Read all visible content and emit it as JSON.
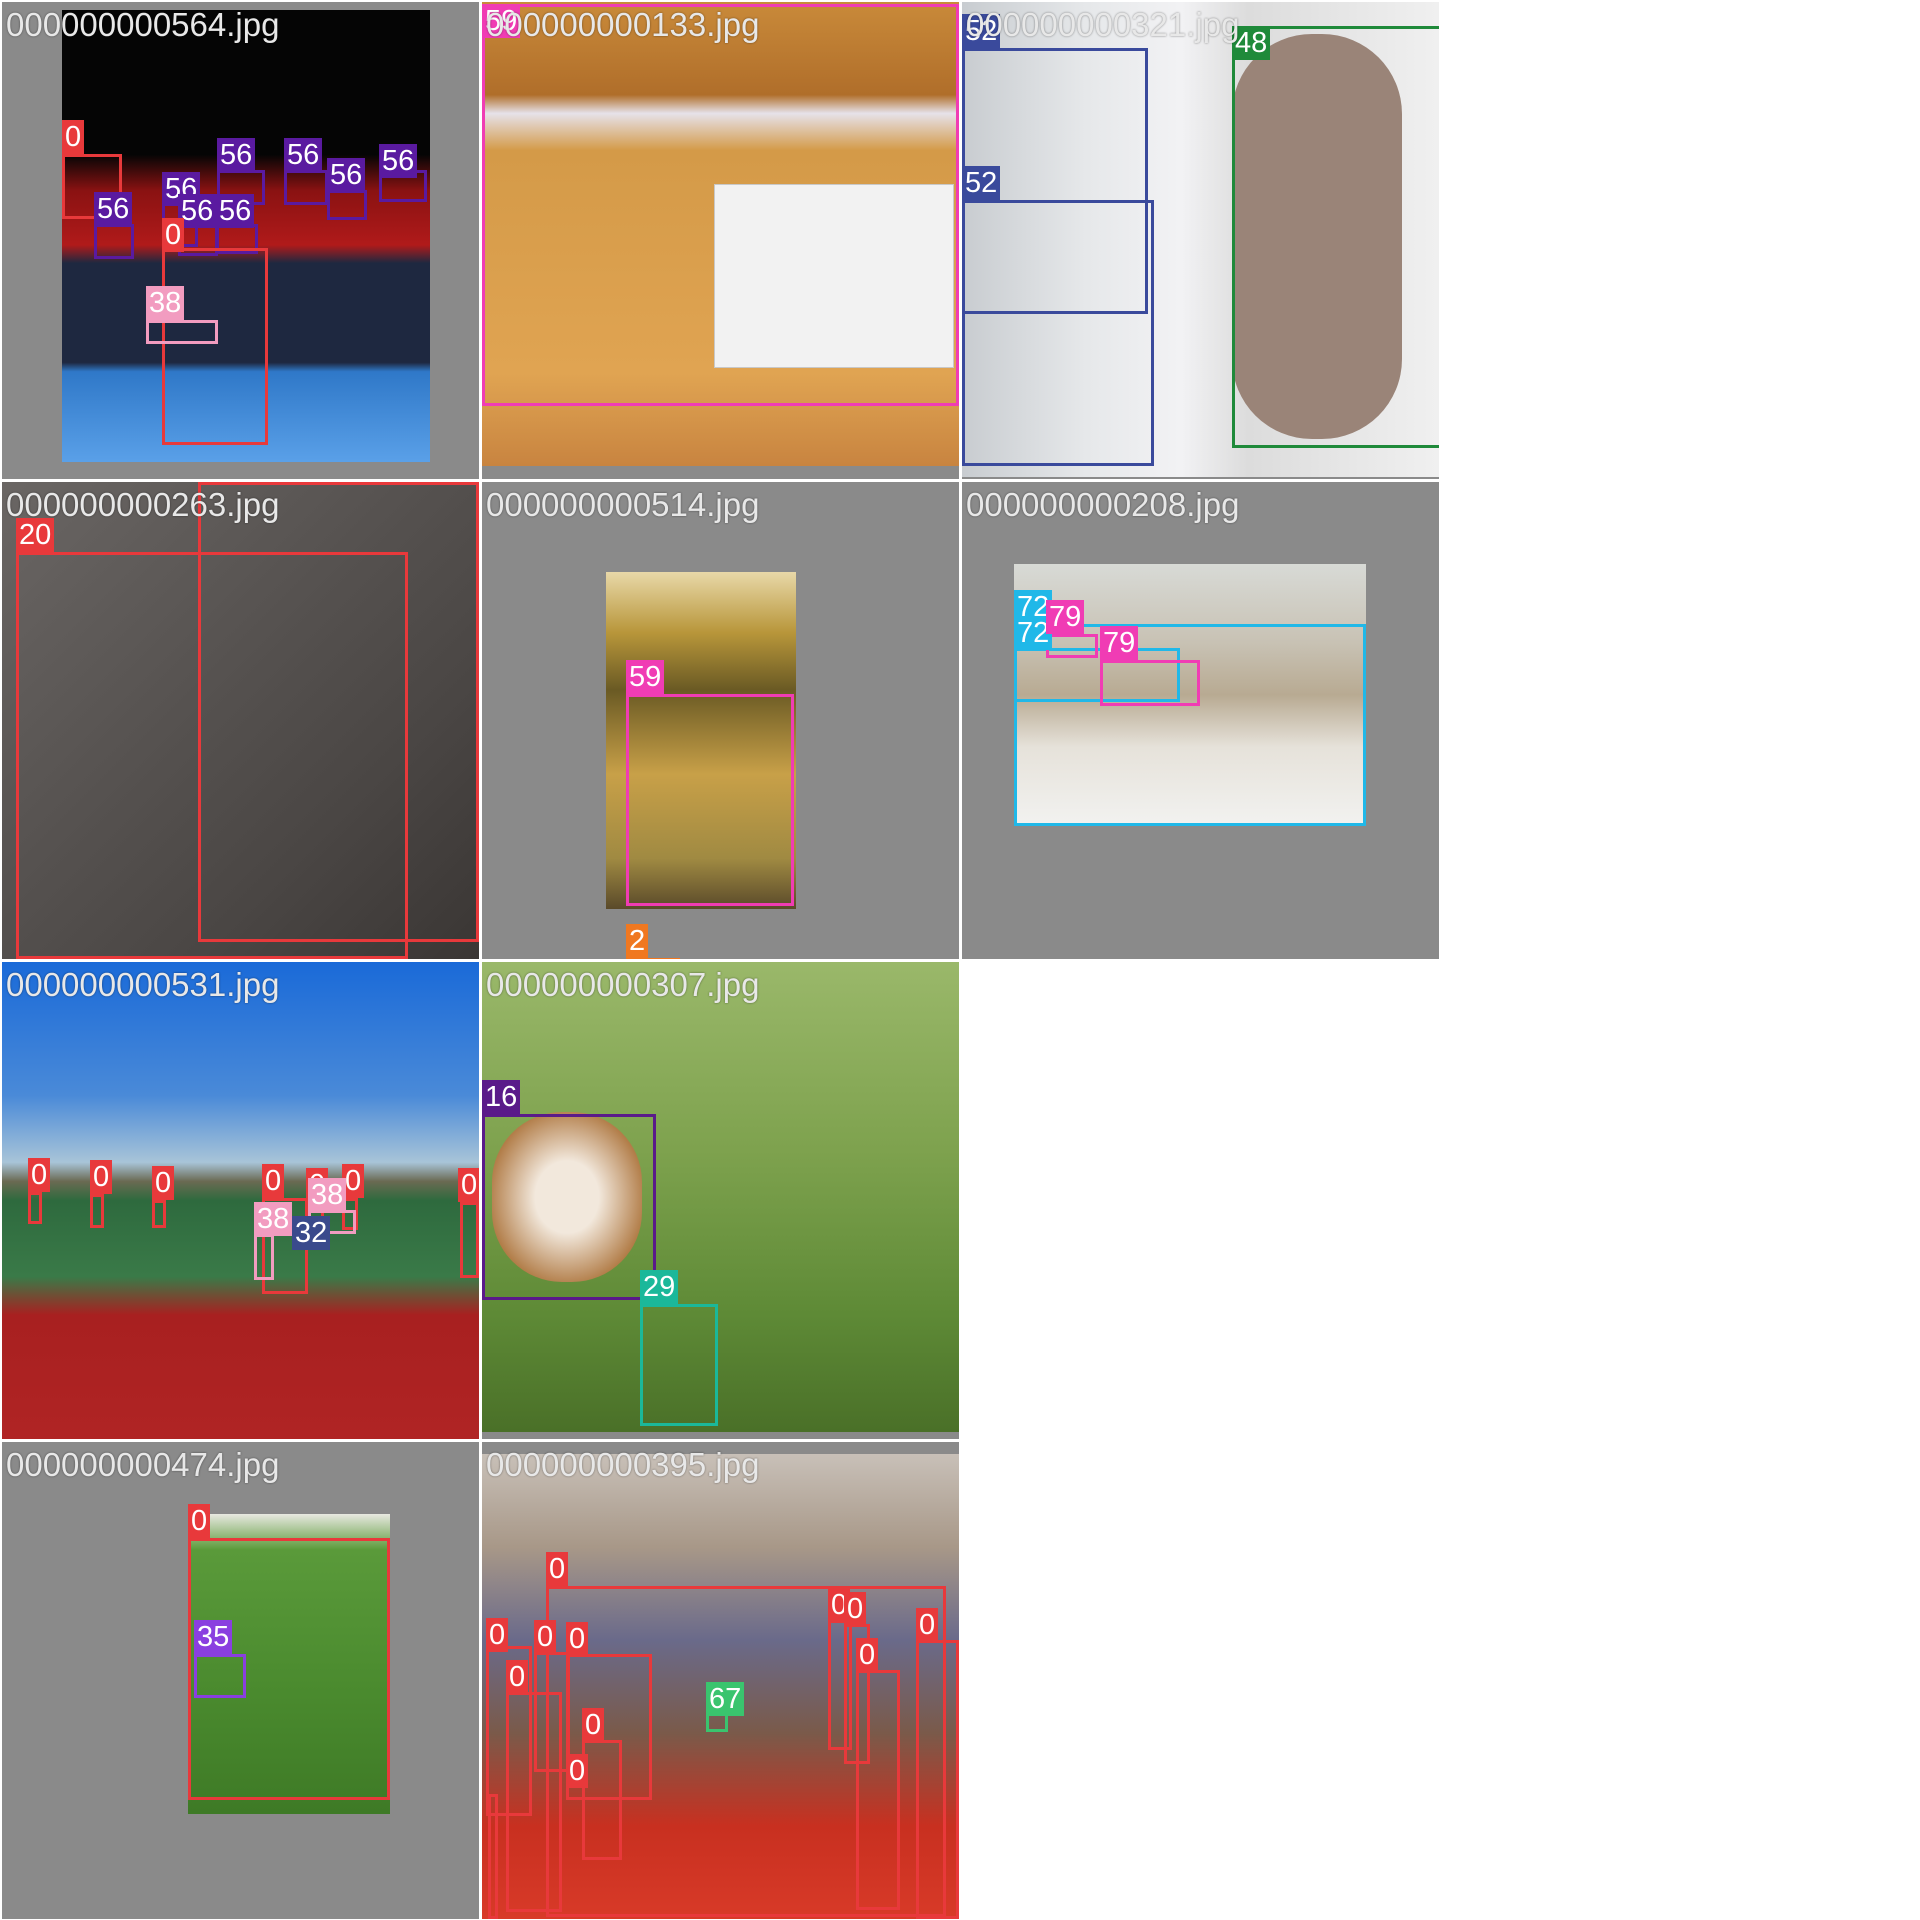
{
  "class_colors": {
    "0": "#e8393b",
    "2": "#f07820",
    "16": "#5a1a8a",
    "20": "#e8393b",
    "29": "#1bb89a",
    "32": "#3a4a8c",
    "35": "#8a3fe0",
    "38": "#f29cc0",
    "48": "#1f8a3a",
    "52": "#3a4a9c",
    "56": "#5a1aa0",
    "59": "#f03cb4",
    "67": "#3ac46e",
    "72": "#20b8e8",
    "79": "#f03cb4"
  },
  "tiles": [
    {
      "filename": "000000000564.jpg",
      "boxes": [
        {
          "label": "0"
        },
        {
          "label": "56"
        },
        {
          "label": "56"
        },
        {
          "label": "56"
        },
        {
          "label": "56"
        },
        {
          "label": "56"
        },
        {
          "label": "56"
        },
        {
          "label": "56"
        },
        {
          "label": "56"
        },
        {
          "label": "0"
        },
        {
          "label": "38"
        }
      ]
    },
    {
      "filename": "000000000133.jpg",
      "boxes": [
        {
          "label": "59"
        }
      ]
    },
    {
      "filename": "000000000321.jpg",
      "boxes": [
        {
          "label": "52"
        },
        {
          "label": "52"
        },
        {
          "label": "48"
        }
      ]
    },
    {
      "filename": "000000000263.jpg",
      "boxes": [
        {
          "label": "20"
        },
        {
          "label": "20"
        }
      ]
    },
    {
      "filename": "000000000514.jpg",
      "boxes": [
        {
          "label": "59"
        },
        {
          "label": "2"
        }
      ]
    },
    {
      "filename": "000000000208.jpg",
      "boxes": [
        {
          "label": "72"
        },
        {
          "label": "72"
        },
        {
          "label": "79"
        },
        {
          "label": "79"
        }
      ]
    },
    {
      "filename": "000000000531.jpg",
      "boxes": [
        {
          "label": "0"
        },
        {
          "label": "0"
        },
        {
          "label": "0"
        },
        {
          "label": "0"
        },
        {
          "label": "0"
        },
        {
          "label": "0"
        },
        {
          "label": "0"
        },
        {
          "label": "38"
        },
        {
          "label": "38"
        },
        {
          "label": "32"
        }
      ]
    },
    {
      "filename": "000000000307.jpg",
      "boxes": [
        {
          "label": "16"
        },
        {
          "label": "29"
        }
      ]
    },
    {
      "filename": "000000000474.jpg",
      "boxes": [
        {
          "label": "0"
        },
        {
          "label": "35"
        }
      ]
    },
    {
      "filename": "000000000395.jpg",
      "boxes": [
        {
          "label": "0"
        },
        {
          "label": "0"
        },
        {
          "label": "0"
        },
        {
          "label": "0"
        },
        {
          "label": "0"
        },
        {
          "label": "0"
        },
        {
          "label": "0"
        },
        {
          "label": "0"
        },
        {
          "label": "0"
        },
        {
          "label": "0"
        },
        {
          "label": "0"
        },
        {
          "label": "67"
        }
      ]
    }
  ]
}
